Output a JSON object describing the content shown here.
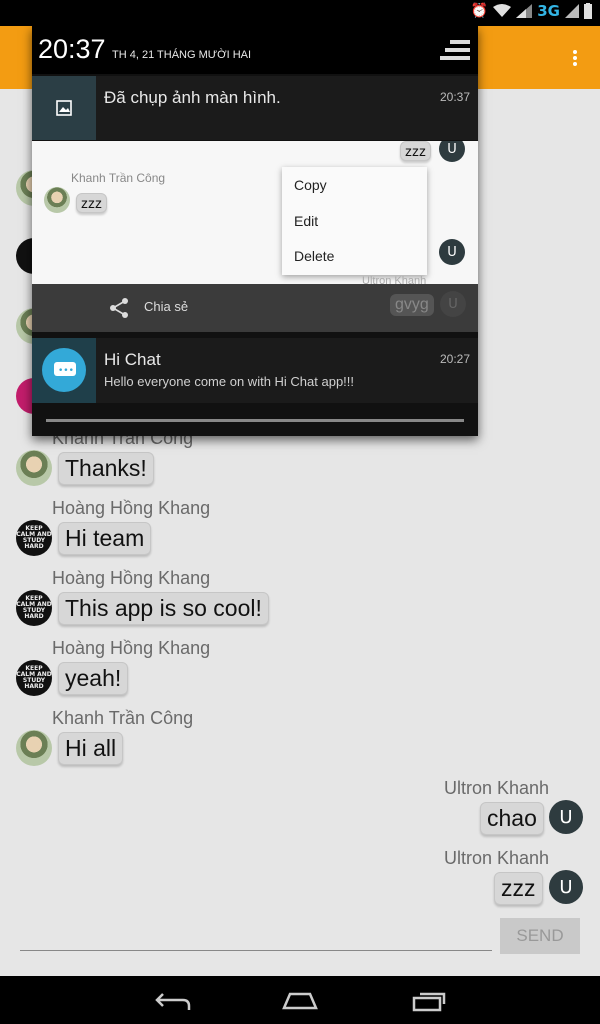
{
  "status_bar": {
    "network_label": "3G"
  },
  "chat": {
    "messages": [
      {
        "sender": "Khanh Trần Công",
        "text": "Thanks!"
      },
      {
        "sender": "Hoàng Hồng Khang",
        "text": "Hi team"
      },
      {
        "sender": "Hoàng Hồng Khang",
        "text": "This app is so cool!"
      },
      {
        "sender": "Hoàng Hồng Khang",
        "text": "yeah!"
      },
      {
        "sender": "Khanh Trần Công",
        "text": "Hi all"
      },
      {
        "sender": "Ultron Khanh",
        "text": "chao"
      },
      {
        "sender": "Ultron Khanh",
        "text": "zzz"
      }
    ],
    "avatar_u_letter": "U",
    "avatar_keep_text": "KEEP CALM AND STUDY HARD",
    "partial_sender": "Khanh Trần Công"
  },
  "input": {
    "send_label": "SEND"
  },
  "shade": {
    "time": "20:37",
    "date": "TH 4, 21 THÁNG MƯỜI HAI",
    "screenshot_notification": {
      "title": "Đã chụp ảnh màn hình.",
      "time": "20:37"
    },
    "preview": {
      "sender": "Khanh Trần Công",
      "bubble_left": "zzz",
      "bubble_right_top": "zzz",
      "partial_sender_right": "Ultron Khanh",
      "bubble_right_bottom": "gvyg",
      "context_menu": [
        "Copy",
        "Edit",
        "Delete"
      ]
    },
    "share_label": "Chia sẻ",
    "hichat_notification": {
      "title": "Hi Chat",
      "text": "Hello everyone come on with Hi Chat app!!!",
      "time": "20:27"
    }
  },
  "colors": {
    "appbar": "#f39c12",
    "status_network": "#33b5e5",
    "avatar_u": "#2e3b3f"
  }
}
